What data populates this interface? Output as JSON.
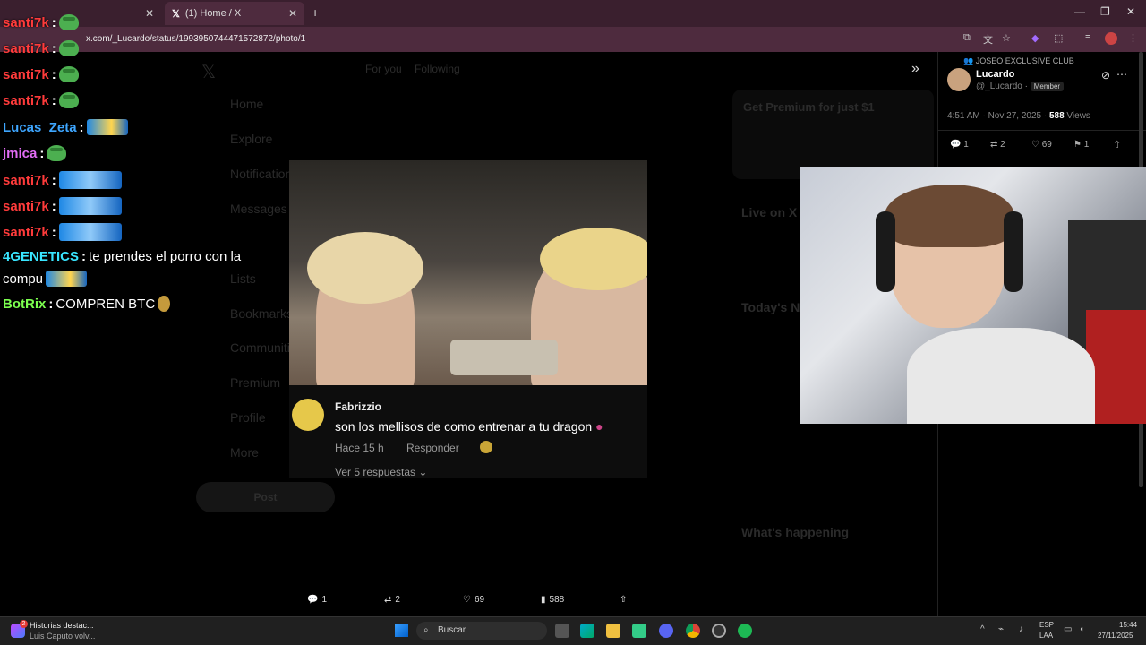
{
  "browser": {
    "tabs": [
      {
        "label": ""
      },
      {
        "label": "(1) Home / X"
      }
    ],
    "new_tab": "+",
    "url": "x.com/_Lucardo/status/1993950744471572872/photo/1",
    "window_controls": [
      "—",
      "❐",
      "✕"
    ]
  },
  "twitter_bg": {
    "nav": [
      "Home",
      "Explore",
      "Notifications",
      "Messages",
      "Lists",
      "Bookmarks",
      "Communities",
      "Premium",
      "Profile",
      "More"
    ],
    "post_button": "Post",
    "feed_tabs": [
      "For you",
      "Following"
    ],
    "premium_title": "Get Premium for just $1",
    "live_title": "Live on X",
    "news_title": "Today's News",
    "whats_happening": "What's happening"
  },
  "chat": [
    {
      "user": "santi7k",
      "color": "#ff3b3b",
      "emote": "frog"
    },
    {
      "user": "santi7k",
      "color": "#ff3b3b",
      "emote": "frog"
    },
    {
      "user": "santi7k",
      "color": "#ff3b3b",
      "emote": "frog"
    },
    {
      "user": "santi7k",
      "color": "#ff3b3b",
      "emote": "frog"
    },
    {
      "user": "Lucas_Zeta",
      "color": "#3ea6ff",
      "emote": "car"
    },
    {
      "user": "jmica",
      "color": "#e26cf5",
      "emote": "frog"
    },
    {
      "user": "santi7k",
      "color": "#ff3b3b",
      "emote": "car"
    },
    {
      "user": "santi7k",
      "color": "#ff3b3b",
      "emote": "car"
    },
    {
      "user": "santi7k",
      "color": "#ff3b3b",
      "emote": "car"
    },
    {
      "user": "4GENETICS",
      "color": "#39e5ff",
      "message": "te prendes el porro con la",
      "message2": "compu"
    },
    {
      "user": "BotRix",
      "color": "#7cff4f",
      "message": "COMPREN BTC"
    }
  ],
  "media": {
    "comment_author": "Fabrizzio",
    "comment_text": "son los mellisos de como entrenar a tu dragon",
    "comment_time": "Hace 15 h",
    "reply": "Responder",
    "view_replies": "Ver 5 respuestas"
  },
  "post": {
    "community": "JOSEO EXCLUSIVE CLUB",
    "author": "Lucardo",
    "handle": "@_Lucardo",
    "badge": "Member",
    "timestamp": "4:51 AM · Nov 27, 2025 · ",
    "views": "588",
    "views_label": "Views",
    "replies": "1",
    "reposts": "2",
    "likes": "69",
    "bookmarks": "1"
  },
  "bottom_bar": {
    "replies": "1",
    "reposts": "2",
    "likes": "69",
    "views": "588"
  },
  "taskbar": {
    "news_title": "Historias destac...",
    "news_sub": "Luis Caputo volv...",
    "news_badge": "2",
    "search": "Buscar",
    "lang1": "ESP",
    "lang2": "LAA",
    "time": "15:44",
    "date": "27/11/2025"
  },
  "colors": {
    "accent": "#1d9bf0",
    "tabbar": "#3a1f2e",
    "addrbar": "#4e2b3e"
  }
}
